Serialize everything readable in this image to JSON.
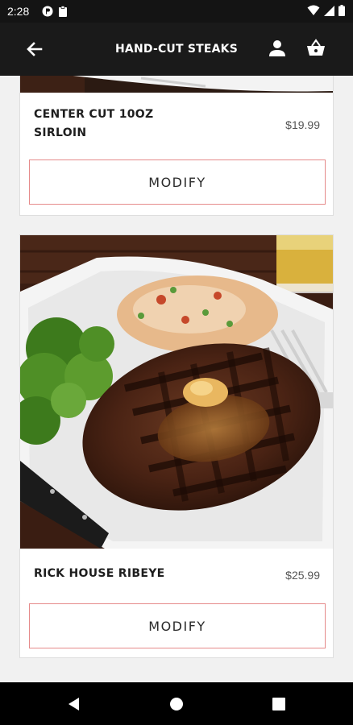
{
  "status_bar": {
    "time": "2:28",
    "icons_left": [
      "p-badge-icon",
      "clipboard-icon"
    ],
    "icons_right": [
      "wifi-icon",
      "signal-icon",
      "battery-icon"
    ]
  },
  "app_bar": {
    "title": "HAND-CUT STEAKS",
    "back_icon": "arrow-back-icon",
    "user_icon": "person-icon",
    "basket_icon": "basket-icon"
  },
  "items": [
    {
      "name_line1": "CENTER CUT 10OZ",
      "name_line2": "SIRLOIN",
      "price": "$19.99",
      "button_label": "MODIFY"
    },
    {
      "name_line1": "RICK HOUSE RIBEYE",
      "price": "$25.99",
      "button_label": "MODIFY"
    }
  ],
  "nav_bar": {
    "back": "triangle-back-icon",
    "home": "circle-home-icon",
    "recents": "square-recents-icon"
  },
  "colors": {
    "app_bar": "#1a1a1a",
    "button_border": "#e58a8a",
    "background": "#f1f1f1",
    "text_dark": "#1e1e1e"
  }
}
